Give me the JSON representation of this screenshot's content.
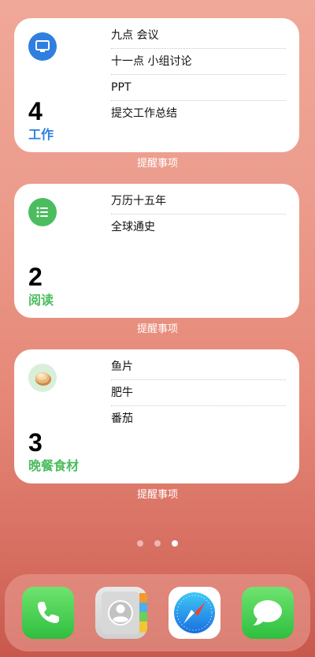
{
  "widgets": [
    {
      "count": "4",
      "list_name": "工作",
      "color": "#2e7fe0",
      "icon": "monitor-icon",
      "items": [
        "九点 会议",
        "十一点 小组讨论",
        "PPT",
        "提交工作总结"
      ],
      "label": "提醒事项"
    },
    {
      "count": "2",
      "list_name": "阅读",
      "color": "#4bbd5e",
      "icon": "list-icon",
      "items": [
        "万历十五年",
        "全球通史"
      ],
      "label": "提醒事项"
    },
    {
      "count": "3",
      "list_name": "晚餐食材",
      "color": "#4bbd5e",
      "icon": "pancake-icon",
      "items": [
        "鱼片",
        "肥牛",
        "番茄"
      ],
      "label": "提醒事项"
    }
  ],
  "page_dots": {
    "count": 3,
    "active_index": 2
  },
  "dock": {
    "apps": [
      "phone-app-icon",
      "contacts-app-icon",
      "safari-app-icon",
      "messages-app-icon"
    ]
  }
}
